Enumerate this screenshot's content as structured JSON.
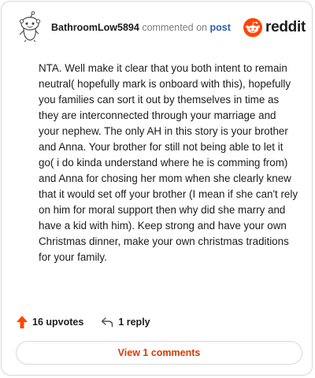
{
  "comment": {
    "username": "BathroomLow5894",
    "action_text": "commented on",
    "post_link": "post",
    "brand_word": "reddit",
    "body": "NTA. Well make it clear that you both intent to remain neutral( hopefully mark is onboard with this), hopefully you families can sort it out by themselves in time as they are interconnected through your marriage and your nephew. The only AH in this story is your brother and Anna. Your brother for still not being able to let it go( i do kinda understand where he is comming from) and Anna for chosing her mom when she clearly knew that it would set off your brother (I mean if she can't rely on him for moral support then why did she marry and have a kid with him). Keep strong and have your own Christmas dinner, make your own christmas traditions for your family."
  },
  "footer": {
    "upvotes_label": "16 upvotes",
    "reply_label": "1 reply"
  },
  "view_comments_label": "View 1 comments",
  "colors": {
    "accent": "#ff4500",
    "link": "#2a5db0",
    "view_button_text": "#d93a00",
    "muted": "#7c7c7c",
    "border": "#d8d8d8"
  },
  "icons": {
    "avatar": "snoo-avatar",
    "brand": "reddit-logo-icon",
    "upvote": "upvote-arrow-icon",
    "reply": "reply-arrow-icon"
  }
}
